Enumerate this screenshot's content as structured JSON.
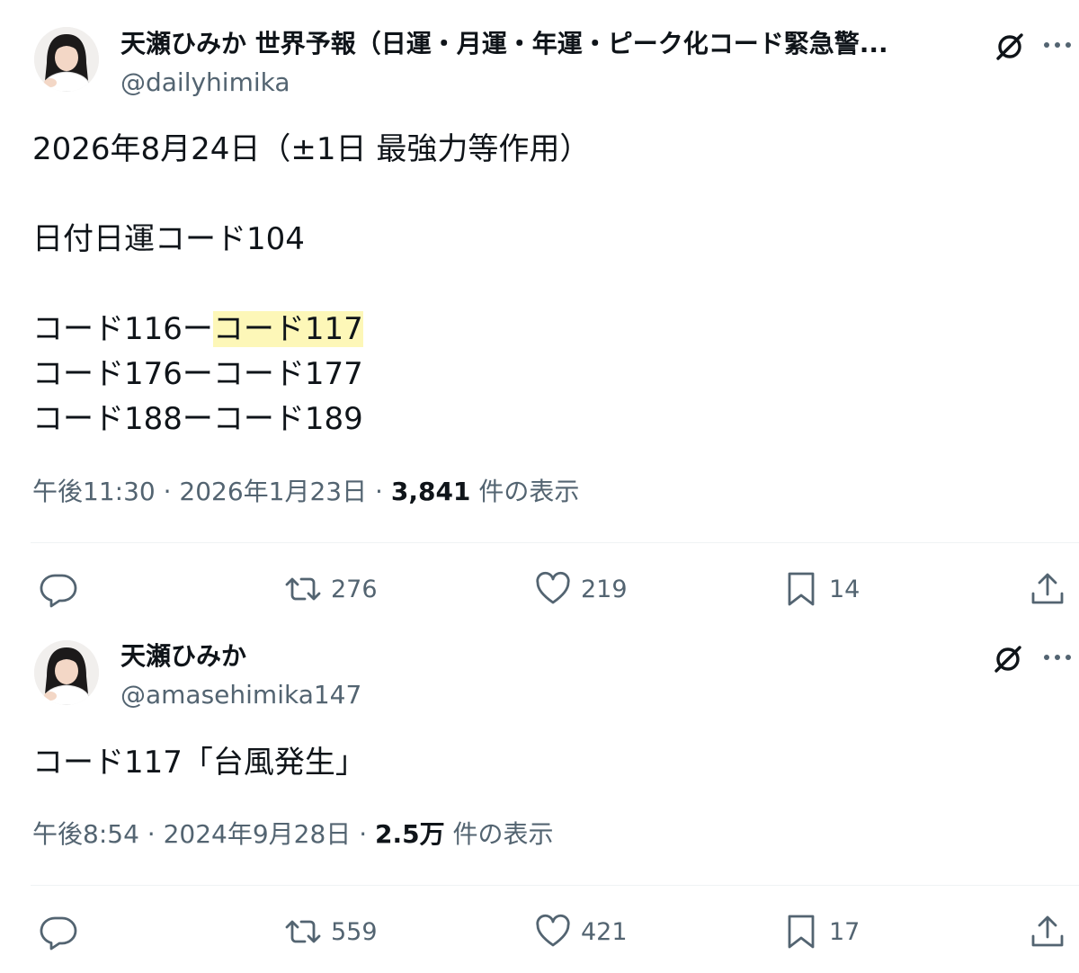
{
  "tweets": [
    {
      "display_name": "天瀬ひみか 世界予報（日運・月運・年運・ピーク化コード緊急警...",
      "handle": "@dailyhimika",
      "body": {
        "line1": "2026年8月24日（±1日 最強力等作用）",
        "line2": "日付日運コード104",
        "line3_prefix": "コード116ー",
        "line3_highlight": "コード117",
        "line4": "コード176ーコード177",
        "line5": "コード188ーコード189"
      },
      "time": "午後11:30",
      "date": "2026年1月23日",
      "views": "3,841",
      "views_label": "件の表示",
      "retweets": "276",
      "likes": "219",
      "bookmarks": "14"
    },
    {
      "display_name": "天瀬ひみか",
      "handle": "@amasehimika147",
      "body": {
        "line1": "コード117「台風発生」"
      },
      "time": "午後8:54",
      "date": "2024年9月28日",
      "views": "2.5万",
      "views_label": "件の表示",
      "retweets": "559",
      "likes": "421",
      "bookmarks": "17"
    }
  ],
  "meta_separator": "·",
  "icons": [
    "avatar-photo",
    "grok-icon",
    "more-icon",
    "reply-icon",
    "retweet-icon",
    "like-icon",
    "bookmark-icon",
    "share-icon"
  ],
  "colors": {
    "text": "#0f1419",
    "secondary": "#536471",
    "highlight": "#fdf7b8",
    "divider": "#eff3f4"
  }
}
